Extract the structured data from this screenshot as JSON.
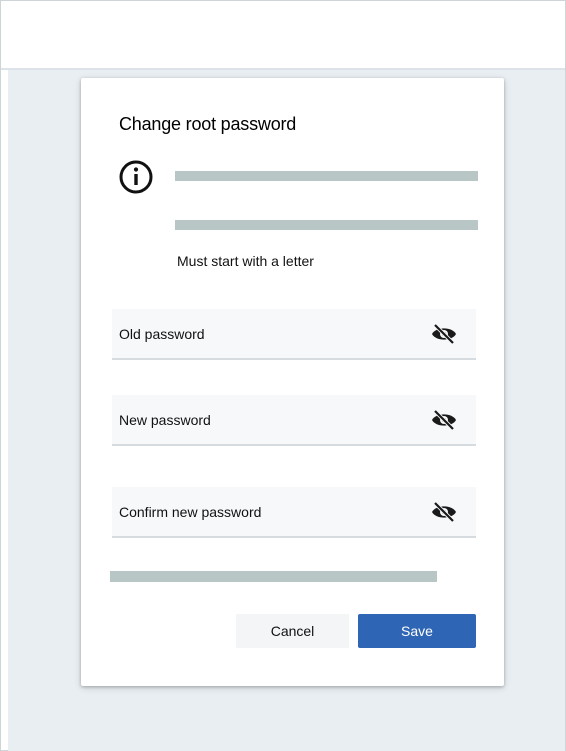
{
  "dialog": {
    "title": "Change root password",
    "hint": "Must start with a letter",
    "fields": [
      {
        "label": "Old password"
      },
      {
        "label": "New password"
      },
      {
        "label": "Confirm new password"
      }
    ],
    "cancel_label": "Cancel",
    "save_label": "Save"
  },
  "icons": {
    "info": "info-icon",
    "eye": "eye-off-icon"
  },
  "colors": {
    "primary": "#2f65b5",
    "placeholder_bar": "#b9c6c6",
    "backdrop": "#e9eef2"
  }
}
